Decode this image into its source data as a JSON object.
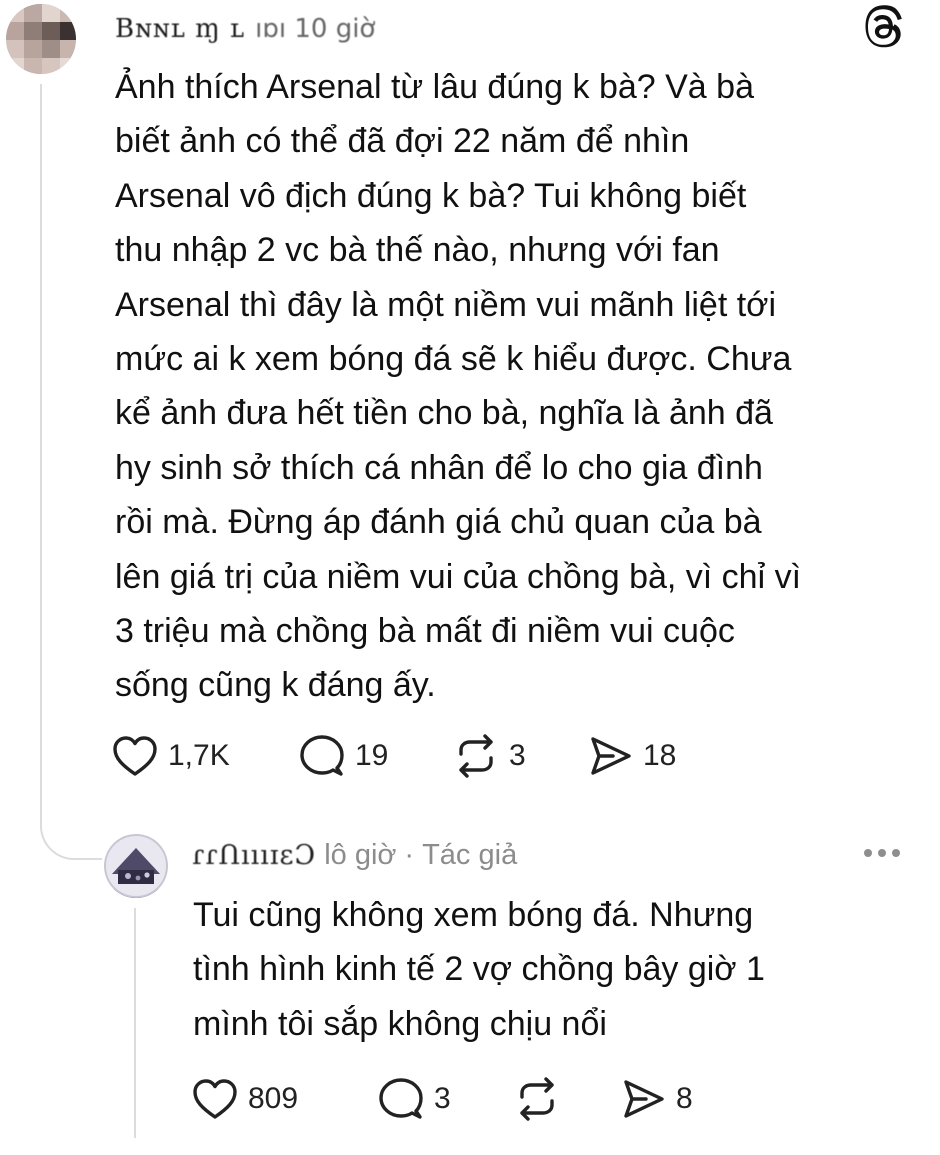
{
  "main_post": {
    "author": "Bɴɴʟ ɱ ʟ",
    "time": "ıɒı 10 giờ",
    "text": "Ảnh thích Arsenal từ lâu đúng k bà? Và bà\nbiết ảnh có thể đã đợi 22 năm để nhìn\nArsenal vô địch đúng k bà? Tui không biết\nthu nhập 2 vc bà thế nào, nhưng với fan\nArsenal thì đây là một niềm vui mãnh liệt tới\nmức ai k xem bóng đá sẽ k hiểu được. Chưa\nkể ảnh đưa hết tiền cho bà, nghĩa là ảnh đã\nhy sinh sở thích cá nhân để lo cho gia đình\nrồi mà. Đừng áp đánh giá chủ quan của bà\nlên giá trị của niềm vui của chồng bà, vì chỉ vì\n3 triệu mà chồng bà mất đi niềm vui cuộc\nsống cũng k đáng ấy.",
    "likes": "1,7K",
    "replies": "19",
    "reposts": "3",
    "shares": "18"
  },
  "reply": {
    "author": "ɾɾՈıııɪɛƆ",
    "time": "lô giờ",
    "separator": "·",
    "author_tag": "Tác giả",
    "text": "Tui cũng không xem bóng đá. Nhưng\ntình hình kinh tế 2 vợ chồng bây giờ 1\nmình tôi sắp không chịu nổi",
    "likes": "809",
    "replies": "3",
    "reposts": "",
    "shares": "8"
  },
  "icons": {
    "logo": "threads-logo-icon",
    "like": "heart-icon",
    "reply": "comment-bubble-icon",
    "repost": "repost-icon",
    "share": "share-arrow-icon",
    "more": "more-dots-icon"
  },
  "colors": {
    "text": "#111111",
    "muted": "#8c8c8c",
    "thread_line": "#dcdcdc"
  }
}
